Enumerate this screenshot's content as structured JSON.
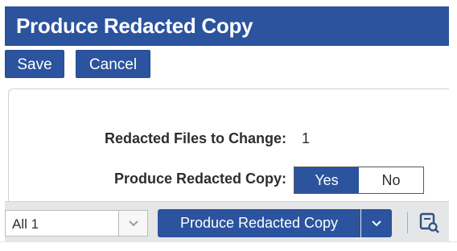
{
  "window": {
    "title": "Produce Redacted Copy"
  },
  "toolbar": {
    "save_label": "Save",
    "cancel_label": "Cancel"
  },
  "form": {
    "files_label": "Redacted Files to Change:",
    "files_value": "1",
    "produce_label": "Produce Redacted Copy:",
    "toggle": {
      "yes_label": "Yes",
      "no_label": "No",
      "selected": "Yes"
    }
  },
  "bottom_bar": {
    "scope_select": {
      "value": "All 1"
    },
    "action_button_label": "Produce Redacted Copy",
    "icons": [
      "chevron-down-icon",
      "document-search-icon"
    ]
  },
  "colors": {
    "accent": "#2b539e",
    "bar": "#e5e6e8",
    "text": "#2e2e2e"
  }
}
